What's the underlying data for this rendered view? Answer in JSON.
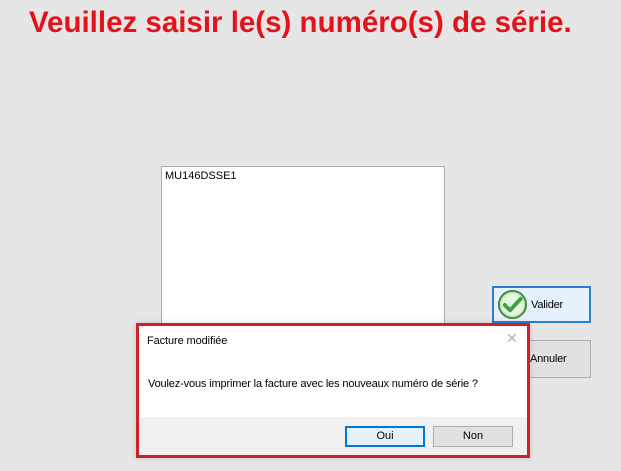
{
  "heading": "Veuillez saisir le(s) numéro(s) de série.",
  "serial_input": {
    "value": "MU146DSSE1"
  },
  "buttons": {
    "validate_label": "Valider",
    "validate_icon": "checkmark-icon",
    "cancel_label": "Annuler"
  },
  "dialog": {
    "title": "Facture modifiée",
    "close_icon": "close-icon",
    "message": "Voulez-vous imprimer la facture avec les nouveaux numéro de série ?",
    "yes_label": "Oui",
    "no_label": "Non"
  },
  "colors": {
    "heading": "#e4131b",
    "dialog_border": "#d0202b",
    "check_fill": "#3ea33c",
    "focus_border": "#0078d7"
  }
}
